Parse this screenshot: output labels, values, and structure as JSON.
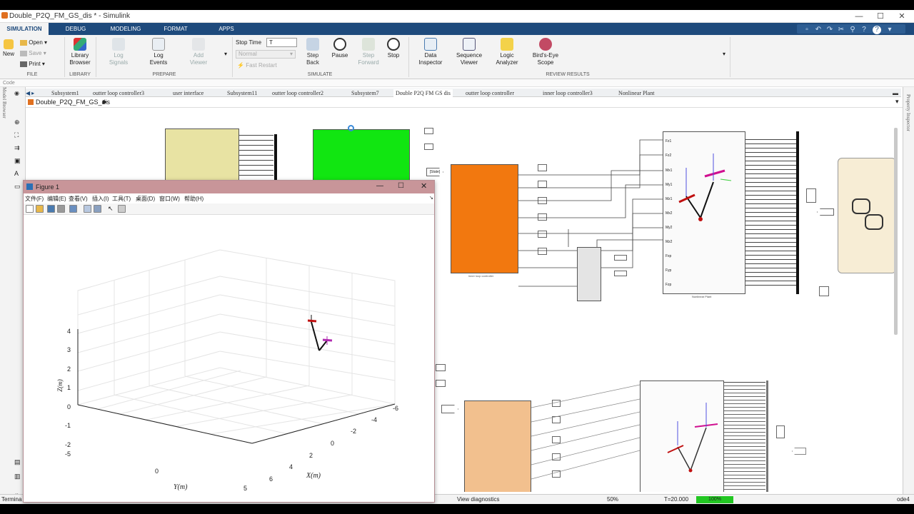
{
  "window": {
    "title": "Double_P2Q_FM_GS_dis * - Simulink"
  },
  "ribbon_tabs": [
    "SIMULATION",
    "DEBUG",
    "MODELING",
    "FORMAT",
    "APPS"
  ],
  "ribbon": {
    "file": {
      "new": "New",
      "open": "Open",
      "save": "Save",
      "print": "Print",
      "section": "FILE"
    },
    "library": {
      "browser": "Library Browser",
      "section": "LIBRARY"
    },
    "prepare": {
      "log_signals": "Log Signals",
      "log_events": "Log Events",
      "add_viewer": "Add Viewer",
      "section": "PREPARE"
    },
    "simulate": {
      "stop_time_label": "Stop Time",
      "stop_time_value": "T",
      "mode": "Normal",
      "fast_restart": "Fast Restart",
      "step_back": "Step Back",
      "pause": "Pause",
      "step_forward": "Step Forward",
      "stop": "Stop",
      "section": "SIMULATE"
    },
    "review": {
      "data_inspector": "Data Inspector",
      "sequence_viewer": "Sequence Viewer",
      "logic_analyzer": "Logic Analyzer",
      "birds_eye": "Bird's-Eye Scope",
      "section": "REVIEW RESULTS"
    }
  },
  "code_label": "Code",
  "model_browser_label": "Model Browser",
  "property_inspector_label": "Property Inspector",
  "model_tabs": [
    "Subsystem1",
    "outter loop controller3",
    "user interface",
    "Subsystem11",
    "outter loop controller2",
    "Subsystem7",
    "Double P2Q FM GS dis",
    "outter loop controller",
    "inner loop controller3",
    "Nonlinear Plant"
  ],
  "breadcrumb": "Double_P2Q_FM_GS_dis",
  "canvas": {
    "plant_label": "Nonlinear Plant",
    "plant_inputs": [
      "Fz1",
      "Fz2",
      "Mx1",
      "My1",
      "Mz1",
      "Mx2",
      "My2",
      "Mz2",
      "Fxp",
      "Fyp",
      "Fzp"
    ],
    "inner_label": "inner loop controller",
    "goto_label": "[State]"
  },
  "figure": {
    "title": "Figure 1",
    "menu": [
      "文件(F)",
      "编辑(E)",
      "查看(V)",
      "插入(I)",
      "工具(T)",
      "桌面(D)",
      "窗口(W)",
      "帮助(H)"
    ],
    "zlabel": "Z(m)",
    "ylabel": "Y(m)",
    "xlabel": "X(m)",
    "zticks": [
      "4",
      "3",
      "2",
      "1",
      "0",
      "-1",
      "-2"
    ],
    "yticks": [
      "-5",
      "0",
      "5"
    ],
    "xticks": [
      "-6",
      "-4",
      "-2",
      "0",
      "2",
      "4",
      "6"
    ]
  },
  "status": {
    "left": "Termina",
    "diagnostics": "View diagnostics",
    "zoom": "50%",
    "time": "T=20.000",
    "progress": "100%",
    "progress_value": 1.0,
    "solver": "ode4"
  }
}
